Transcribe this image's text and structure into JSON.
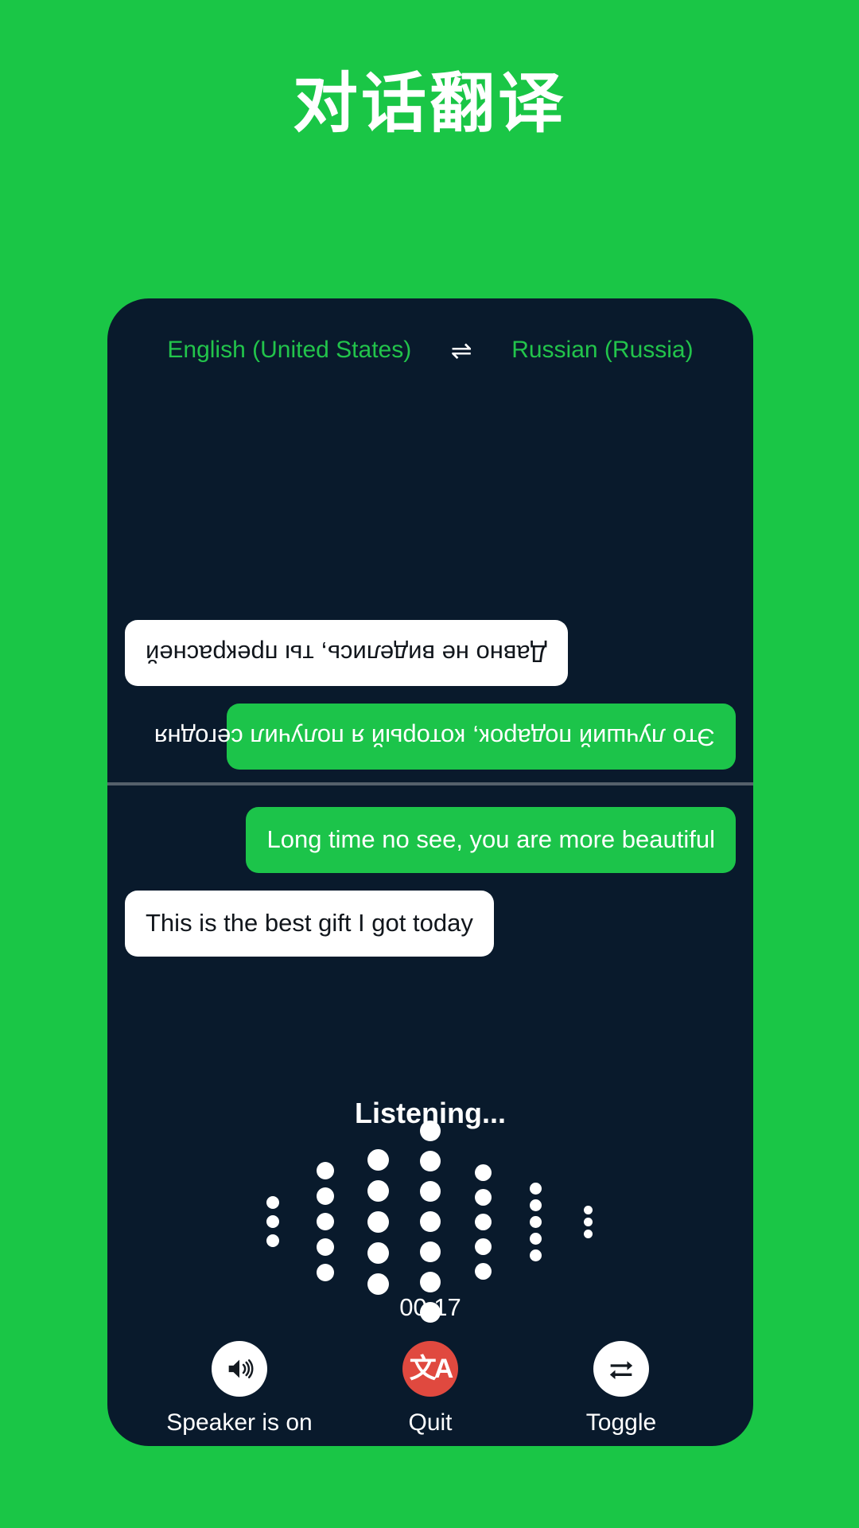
{
  "header": {
    "title": "对话翻译"
  },
  "colors": {
    "background_green": "#1AC646",
    "card_dark": "#091A2C",
    "bubble_green": "#1CC44A",
    "bubble_white": "#FFFFFF",
    "accent_red": "#E0493F",
    "lang_green": "#22C44B",
    "divider": "#55606B"
  },
  "language_bar": {
    "source": "English (United States)",
    "target": "Russian (Russia)",
    "swap_icon": "swap-horizontal-icon",
    "swap_glyph": "⇌"
  },
  "remote_pane": {
    "rotated": true,
    "messages": [
      {
        "text": "Это лучший подарок, который я получил сегодня",
        "style": "green",
        "align": "left"
      },
      {
        "text": "Давно не виделись, ты прекрасней",
        "style": "white",
        "align": "right"
      }
    ]
  },
  "local_pane": {
    "messages": [
      {
        "text": "Long time no see, you are more beautiful",
        "style": "green",
        "align": "right"
      },
      {
        "text": "This is the best gift I got today",
        "style": "white",
        "align": "left"
      }
    ]
  },
  "status": {
    "listening_label": "Listening...",
    "timer": "00:17"
  },
  "waveform": {
    "columns": [
      {
        "dots": 3,
        "size": 16
      },
      {
        "dots": 5,
        "size": 22
      },
      {
        "dots": 5,
        "size": 27
      },
      {
        "dots": 7,
        "size": 26
      },
      {
        "dots": 5,
        "size": 21
      },
      {
        "dots": 5,
        "size": 15
      },
      {
        "dots": 3,
        "size": 11
      }
    ]
  },
  "controls": [
    {
      "label": "Speaker is on",
      "icon": "speaker-on-icon",
      "style": "white"
    },
    {
      "label": "Quit",
      "icon": "translate-icon",
      "style": "red",
      "glyph": "文A"
    },
    {
      "label": "Toggle",
      "icon": "swap-arrows-icon",
      "style": "white"
    }
  ]
}
